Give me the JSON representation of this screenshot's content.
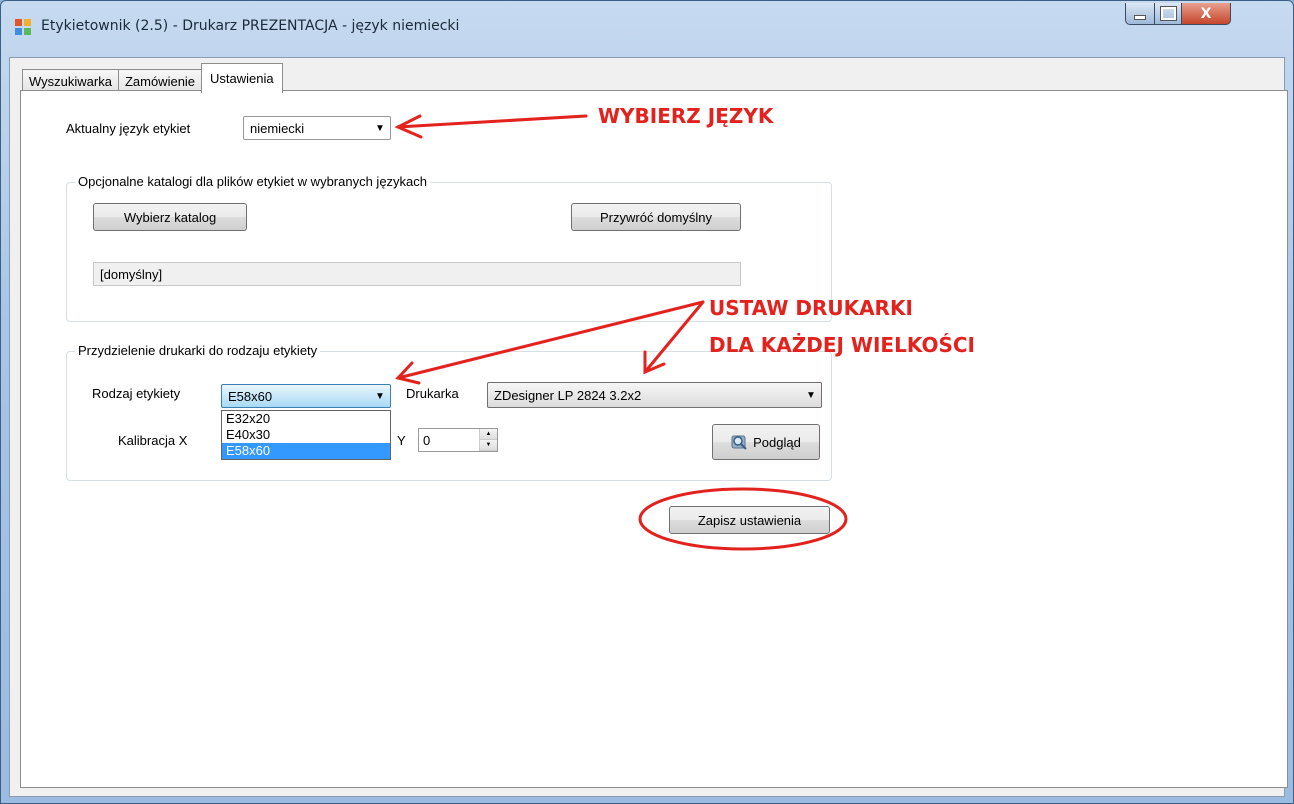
{
  "window": {
    "title": "Etykietownik (2.5) - Drukarz PREZENTACJA - język niemiecki",
    "close_glyph": "X"
  },
  "tabs": [
    {
      "label": "Wyszukiwarka"
    },
    {
      "label": "Zamówienie"
    },
    {
      "label": "Ustawienia"
    }
  ],
  "language": {
    "label": "Aktualny język etykiet",
    "value": "niemiecki"
  },
  "catalog_group": {
    "legend": "Opcjonalne katalogi dla plików etykiet w wybranych językach",
    "choose_button": "Wybierz katalog",
    "restore_button": "Przywróć domyślny",
    "path_value": "[domyślny]"
  },
  "printer_group": {
    "legend": "Przydzielenie drukarki do rodzaju etykiety",
    "label_type_label": "Rodzaj etykiety",
    "label_type_value": "E58x60",
    "label_type_options": [
      "E32x20",
      "E40x30",
      "E58x60"
    ],
    "printer_label": "Drukarka",
    "printer_value": "ZDesigner LP 2824 3.2x2",
    "calib_x_label": "Kalibracja X",
    "calib_y_label": "Y",
    "calib_y_value": "0",
    "preview_button": "Podgląd"
  },
  "save_button": "Zapisz ustawienia",
  "annotations": {
    "choose_language": "WYBIERZ JĘZYK",
    "set_printers_line1": "USTAW DRUKARKI",
    "set_printers_line2": "DLA KAŻDEJ WIELKOŚCI"
  },
  "colors": {
    "annotation": "#e3221e",
    "selection": "#3399ff"
  }
}
